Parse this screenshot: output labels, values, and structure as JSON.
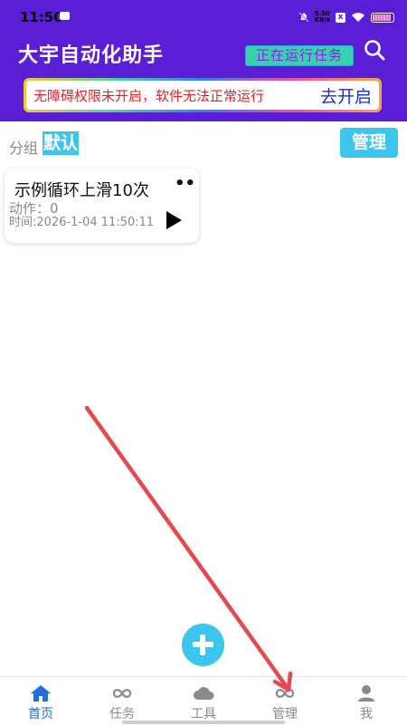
{
  "status_bar": {
    "time": "11:50",
    "net_speed_value": "5.50",
    "net_speed_unit": "KB/s",
    "sim_label": "x"
  },
  "app_bar": {
    "title": "大宇自动化助手",
    "running_chip": "正在运行任务",
    "warning_text": "无障碍权限未开启，软件无法正常运行",
    "warning_action": "去开启"
  },
  "group": {
    "label": "分组",
    "current": "默认",
    "manage_button": "管理"
  },
  "task_card": {
    "title": "示例循环上滑10次",
    "more": "••",
    "actions": "动作：0",
    "time": "时间:2026-1-04 11:50:11"
  },
  "bottom_nav": {
    "items": [
      {
        "label": "首页",
        "icon": "home-icon",
        "active": true
      },
      {
        "label": "任务",
        "icon": "infinity-icon",
        "active": false
      },
      {
        "label": "工具",
        "icon": "cloud-icon",
        "active": false
      },
      {
        "label": "管理",
        "icon": "infinity-icon",
        "active": false
      },
      {
        "label": "我",
        "icon": "person-icon",
        "active": false
      }
    ]
  },
  "colors": {
    "primary": "#5a1ed6",
    "accent": "#3cc6ef",
    "warning": "#e8202a",
    "nav_active": "#1f6dde",
    "annotation_arrow": "#e5484d"
  }
}
